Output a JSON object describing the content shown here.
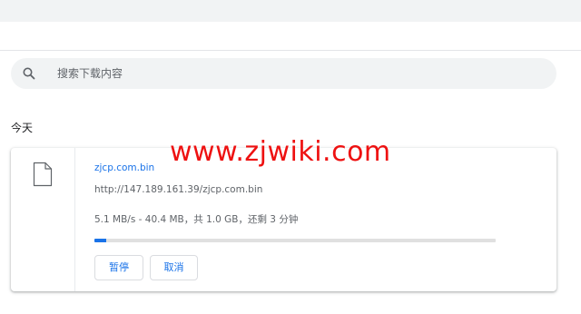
{
  "search": {
    "placeholder": "搜索下载内容"
  },
  "section": {
    "label": "今天"
  },
  "download": {
    "file_name": "zjcp.com.bin",
    "url": "http://147.189.161.39/zjcp.com.bin",
    "status": "5.1 MB/s - 40.4 MB，共 1.0 GB，还剩 3 分钟",
    "progress_fraction": 0.03,
    "pause_label": "暂停",
    "cancel_label": "取消"
  },
  "watermark": {
    "text": "www.zjwiki.com"
  },
  "colors": {
    "accent": "#1a73e8",
    "watermark": "#ee1111",
    "surface": "#f1f3f4"
  },
  "icons": {
    "search": "search-icon",
    "file": "file-icon"
  }
}
